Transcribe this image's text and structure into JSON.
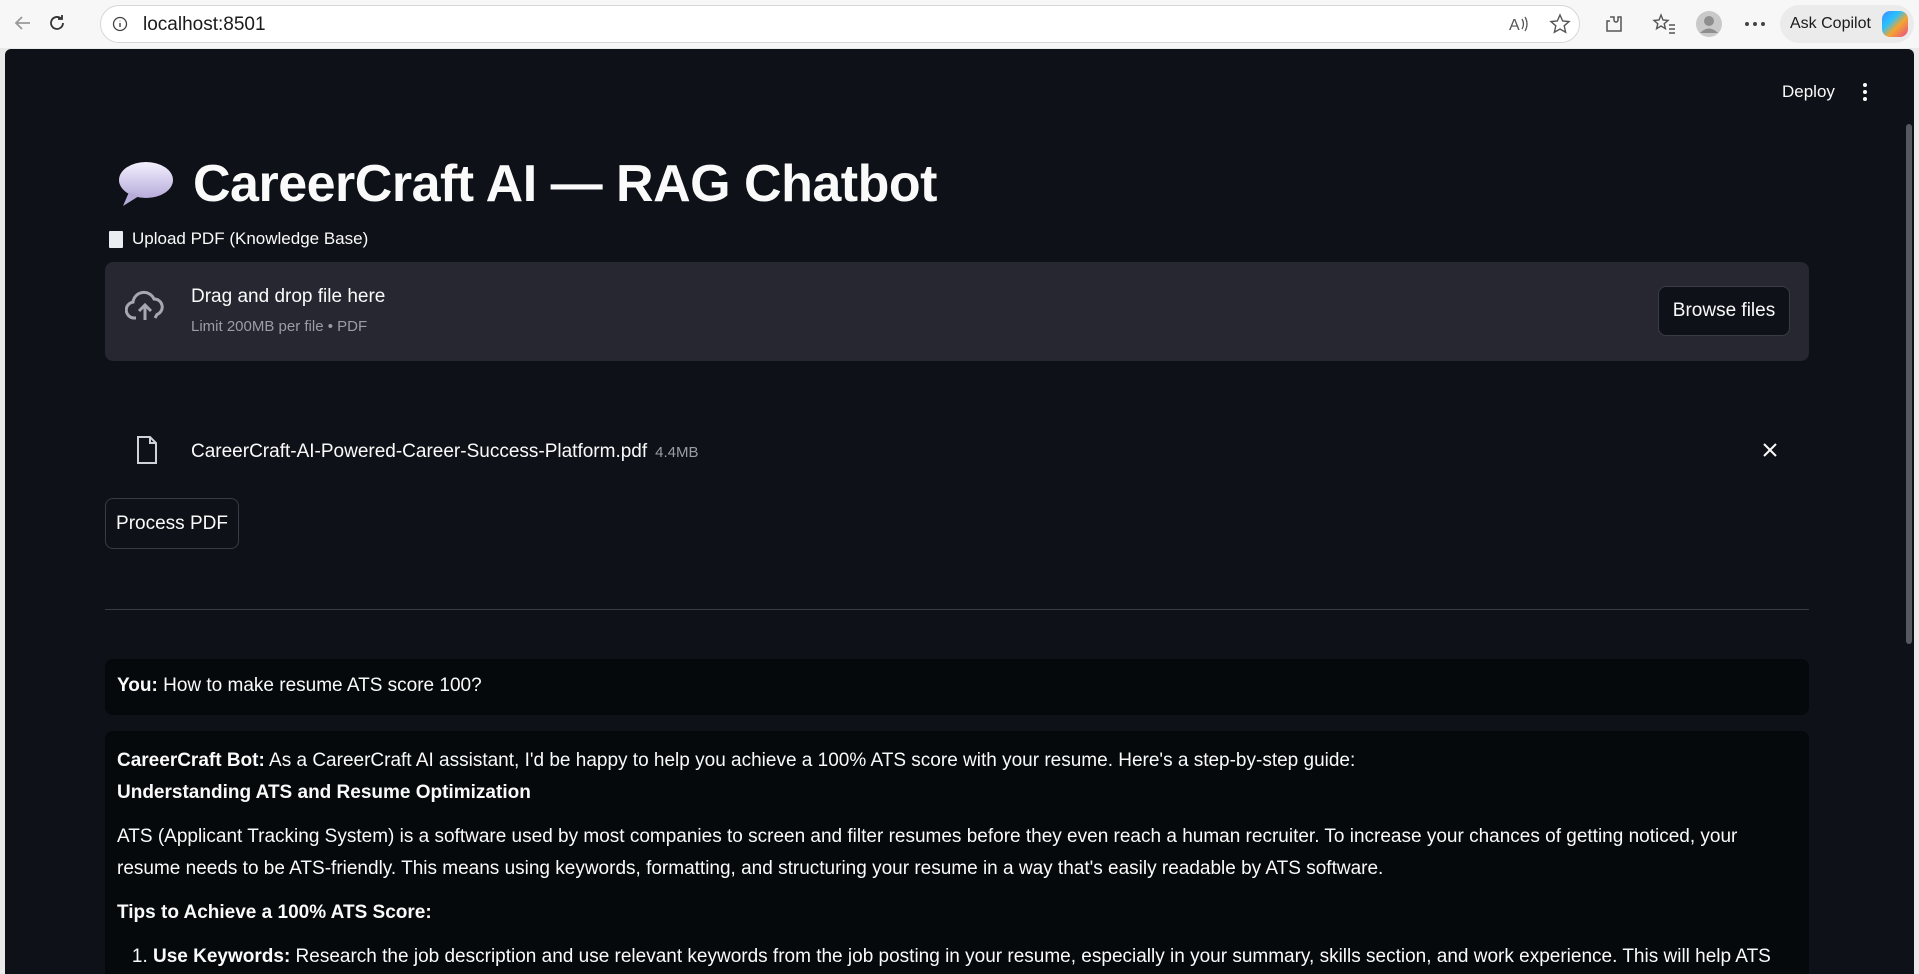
{
  "browser": {
    "url": "localhost:8501",
    "copilot_label": "Ask Copilot"
  },
  "app": {
    "deploy_label": "Deploy",
    "title": "CareerCraft AI — RAG Chatbot",
    "upload_label": "Upload PDF (Knowledge Base)",
    "dropzone": {
      "main": "Drag and drop file here",
      "sub": "Limit 200MB per file • PDF",
      "browse_label": "Browse files"
    },
    "file": {
      "name": "CareerCraft-AI-Powered-Career-Success-Platform.pdf",
      "size": "4.4MB"
    },
    "process_label": "Process PDF",
    "chat": {
      "user": {
        "prefix": "You:",
        "text": " How to make resume ATS score 100?"
      },
      "bot": {
        "prefix": "CareerCraft Bot:",
        "intro": " As a CareerCraft AI assistant, I'd be happy to help you achieve a 100% ATS score with your resume. Here's a step-by-step guide:",
        "heading": "Understanding ATS and Resume Optimization",
        "para": "ATS (Applicant Tracking System) is a software used by most companies to screen and filter resumes before they even reach a human recruiter. To increase your chances of getting noticed, your resume needs to be ATS-friendly. This means using keywords, formatting, and structuring your resume in a way that's easily readable by ATS software.",
        "tips_heading": "Tips to Achieve a 100% ATS Score:",
        "tips": [
          {
            "title": "Use Keywords:",
            "text": " Research the job description and use relevant keywords from the job posting in your resume, especially in your summary, skills section, and work experience. This will help ATS software match your resume with the job requirements."
          }
        ]
      }
    }
  }
}
